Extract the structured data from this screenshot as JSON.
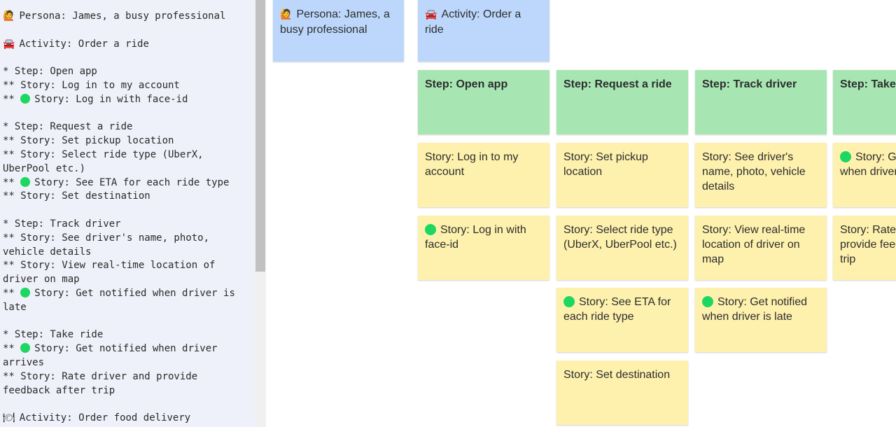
{
  "editor": {
    "lines": [
      {
        "emoji": "🙋",
        "text": "Persona: James, a busy professional"
      },
      {
        "text": ""
      },
      {
        "emoji": "🚘",
        "text": "Activity: Order a ride"
      },
      {
        "text": ""
      },
      {
        "text": "* Step: Open app"
      },
      {
        "text": "** Story: Log in to my account"
      },
      {
        "prefix": "** ",
        "dot": true,
        "text": "Story: Log in with face-id"
      },
      {
        "text": ""
      },
      {
        "text": "* Step: Request a ride"
      },
      {
        "text": "** Story: Set pickup location"
      },
      {
        "text": "** Story: Select ride type (UberX,"
      },
      {
        "text": "UberPool etc.)"
      },
      {
        "prefix": "** ",
        "dot": true,
        "text": "Story: See ETA for each ride type"
      },
      {
        "text": "** Story: Set destination"
      },
      {
        "text": ""
      },
      {
        "text": "* Step: Track driver"
      },
      {
        "text": "** Story: See driver's name, photo,"
      },
      {
        "text": "vehicle details"
      },
      {
        "text": "** Story: View real-time location of"
      },
      {
        "text": "driver on map"
      },
      {
        "prefix": "** ",
        "dot": true,
        "text": "Story: Get notified when driver is"
      },
      {
        "text": "late"
      },
      {
        "text": ""
      },
      {
        "text": "* Step: Take ride"
      },
      {
        "prefix": "** ",
        "dot": true,
        "text": "Story: Get notified when driver"
      },
      {
        "text": "arrives"
      },
      {
        "text": "** Story: Rate driver and provide"
      },
      {
        "text": "feedback after trip"
      },
      {
        "text": ""
      },
      {
        "emoji": "🍽",
        "text": "Activity: Order food delivery"
      }
    ]
  },
  "board": {
    "cards": [
      {
        "id": "persona",
        "color": "blue",
        "emoji": "🙋",
        "text": "Persona: James, a busy professional"
      },
      {
        "id": "activity",
        "color": "blue",
        "emoji": "🚘",
        "text": "Activity: Order a ride"
      },
      {
        "id": "step-open-app",
        "color": "green",
        "text": "Step: Open app"
      },
      {
        "id": "step-request-ride",
        "color": "green",
        "text": "Step: Request a ride"
      },
      {
        "id": "step-track-driver",
        "color": "green",
        "text": "Step: Track driver"
      },
      {
        "id": "step-take-ride",
        "color": "green",
        "text": "Step: Take ride"
      },
      {
        "id": "story-login-account",
        "color": "yellow",
        "text": "Story: Log in to my account"
      },
      {
        "id": "story-login-faceid",
        "color": "yellow",
        "dot": true,
        "text": "Story: Log in with face-id"
      },
      {
        "id": "story-pickup",
        "color": "yellow",
        "text": "Story: Set pickup location"
      },
      {
        "id": "story-ride-type",
        "color": "yellow",
        "text": "Story: Select ride type (UberX, UberPool etc.)"
      },
      {
        "id": "story-eta",
        "color": "yellow",
        "dot": true,
        "text": "Story: See ETA for each ride type"
      },
      {
        "id": "story-destination",
        "color": "yellow",
        "text": "Story: Set destination"
      },
      {
        "id": "story-driver-details",
        "color": "yellow",
        "text": "Story: See driver's name, photo, vehicle details"
      },
      {
        "id": "story-realtime",
        "color": "yellow",
        "text": "Story: View real-time location of driver on map"
      },
      {
        "id": "story-late",
        "color": "yellow",
        "dot": true,
        "text": "Story: Get notified when driver is late"
      },
      {
        "id": "story-arrives",
        "color": "yellow",
        "dot": true,
        "text": "Story: Get notified when driver arrives"
      },
      {
        "id": "story-rate",
        "color": "yellow",
        "text": "Story: Rate driver and provide feedback after trip"
      }
    ]
  }
}
